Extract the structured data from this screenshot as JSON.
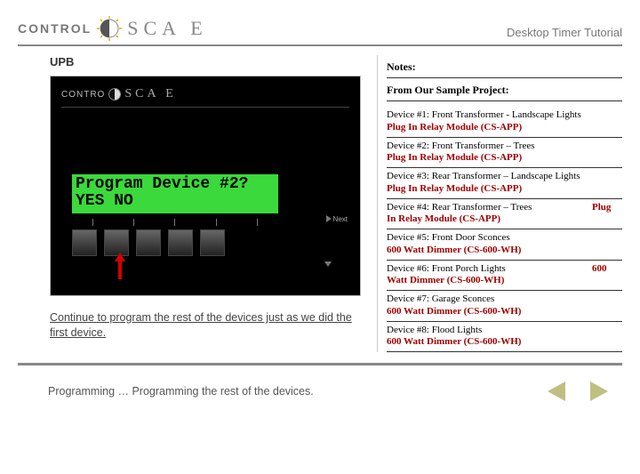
{
  "header": {
    "brand_left": "CONTROL",
    "brand_right": "SCA  E",
    "subtitle": "Desktop Timer Tutorial"
  },
  "left": {
    "section_title": "UPB",
    "panel_brand_left": "CONTRO",
    "panel_brand_right": "SCA E",
    "lcd_line1": " Program Device #2?",
    "lcd_line2": "  YES   NO",
    "nav_next": "Next",
    "caption": "Continue to program the rest of the devices just as we did the first device."
  },
  "notes": {
    "head": "Notes:",
    "sub": "From Our Sample Project:",
    "devices": [
      {
        "l1": "Device #1: Front Transformer - Landscape Lights",
        "l2": "Plug In Relay Module (CS-APP)"
      },
      {
        "l1": "Device #2: Front Transformer – Trees",
        "l2": "Plug In Relay Module (CS-APP)"
      },
      {
        "l1": "Device #3: Rear Transformer – Landscape Lights",
        "l2": "Plug In Relay Module (CS-APP)"
      },
      {
        "l1": "Device #4: Rear Transformer – Trees",
        "l2": "In Relay Module (CS-APP)",
        "ext": "Plug"
      },
      {
        "l1": "Device #5: Front Door Sconces",
        "l2": "600 Watt Dimmer (CS-600-WH)"
      },
      {
        "l1": "Device #6: Front Porch Lights",
        "l2": "Watt Dimmer (CS-600-WH)",
        "ext": "600"
      },
      {
        "l1": "Device #7: Garage Sconces",
        "l2": "600 Watt Dimmer (CS-600-WH)"
      },
      {
        "l1": "Device #8: Flood Lights",
        "l2": "600 Watt Dimmer (CS-600-WH)"
      }
    ]
  },
  "footer": {
    "text": "Programming … Programming the rest of the devices."
  }
}
